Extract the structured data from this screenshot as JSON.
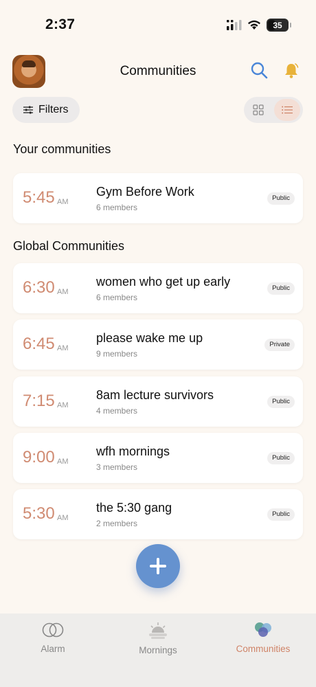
{
  "status": {
    "time": "2:37",
    "battery": "35"
  },
  "header": {
    "title": "Communities",
    "avatar_icon": "avatar-photo"
  },
  "toolbar": {
    "filters_label": "Filters",
    "view_mode": "list"
  },
  "sections": {
    "yours_title": "Your communities",
    "global_title": "Global Communities"
  },
  "your_communities": [
    {
      "time": "5:45",
      "ampm": "AM",
      "name": "Gym Before Work",
      "members": "6 members",
      "badge": "Public"
    }
  ],
  "global_communities": [
    {
      "time": "6:30",
      "ampm": "AM",
      "name": "women who get up early",
      "members": "6 members",
      "badge": "Public"
    },
    {
      "time": "6:45",
      "ampm": "AM",
      "name": "please wake me up",
      "members": "9 members",
      "badge": "Private"
    },
    {
      "time": "7:15",
      "ampm": "AM",
      "name": "8am lecture survivors",
      "members": "4 members",
      "badge": "Public"
    },
    {
      "time": "9:00",
      "ampm": "AM",
      "name": "wfh mornings",
      "members": "3 members",
      "badge": "Public"
    },
    {
      "time": "5:30",
      "ampm": "AM",
      "name": "the 5:30 gang",
      "members": "2 members",
      "badge": "Public"
    }
  ],
  "tabs": [
    {
      "label": "Alarm",
      "icon": "rings-icon",
      "active": false
    },
    {
      "label": "Mornings",
      "icon": "sunrise-icon",
      "active": false
    },
    {
      "label": "Communities",
      "icon": "communities-icon",
      "active": true
    }
  ],
  "colors": {
    "accent": "#cf8367",
    "time_text": "#d08b72",
    "fab": "#6592cf",
    "search": "#4a86d8",
    "bell": "#e8b23a"
  }
}
